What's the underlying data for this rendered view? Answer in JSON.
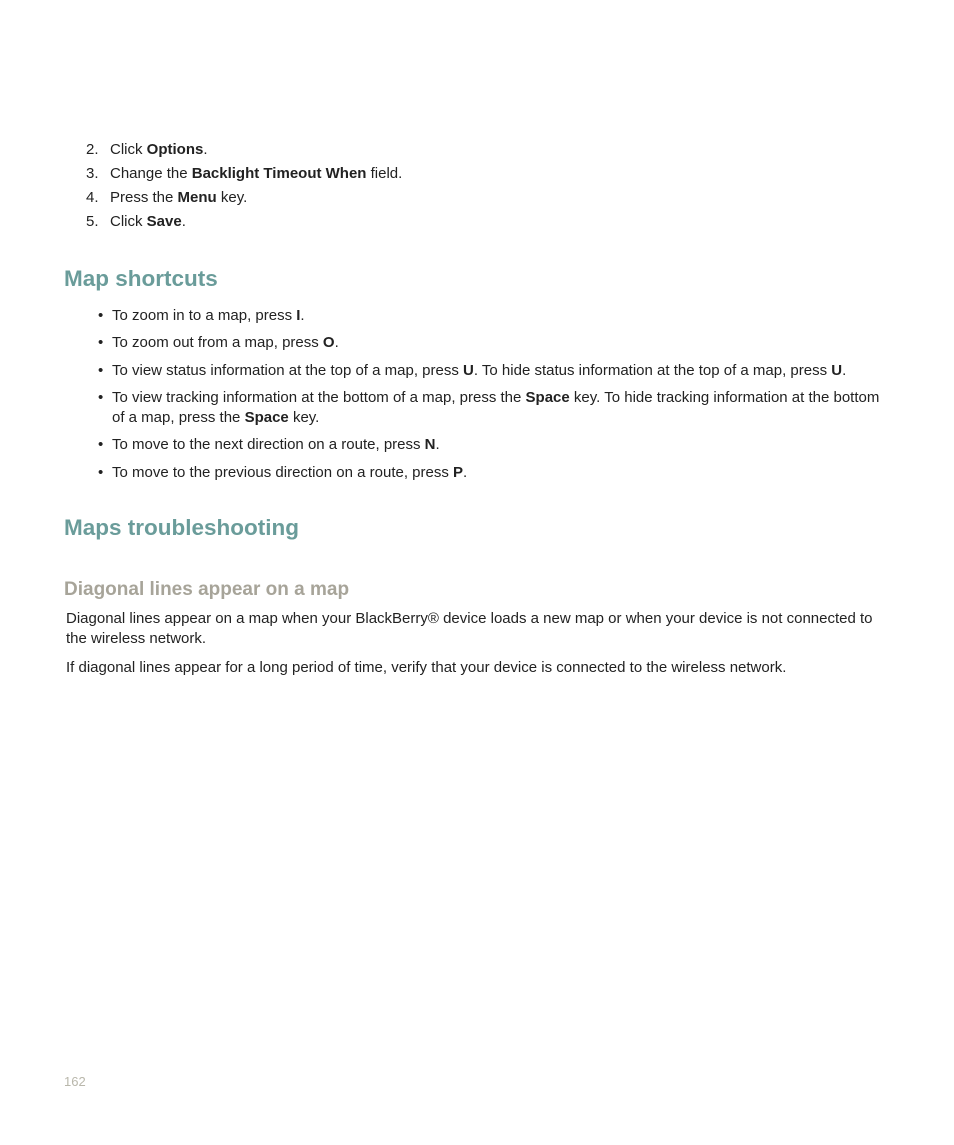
{
  "steps": [
    {
      "num": "2.",
      "parts": [
        "Click ",
        "Options",
        "."
      ]
    },
    {
      "num": "3.",
      "parts": [
        "Change the ",
        "Backlight Timeout When",
        " field."
      ]
    },
    {
      "num": "4.",
      "parts": [
        "Press the ",
        "Menu",
        " key."
      ]
    },
    {
      "num": "5.",
      "parts": [
        "Click ",
        "Save",
        "."
      ]
    }
  ],
  "section1": {
    "title": "Map shortcuts",
    "bullets": [
      [
        {
          "t": "To zoom in to a map, press "
        },
        {
          "t": "I",
          "b": true
        },
        {
          "t": "."
        }
      ],
      [
        {
          "t": "To zoom out from a map, press "
        },
        {
          "t": "O",
          "b": true
        },
        {
          "t": "."
        }
      ],
      [
        {
          "t": "To view status information at the top of a map, press "
        },
        {
          "t": "U",
          "b": true
        },
        {
          "t": ". To hide status information at the top of a map, press "
        },
        {
          "t": "U",
          "b": true
        },
        {
          "t": "."
        }
      ],
      [
        {
          "t": "To view tracking information at the bottom of a map, press the "
        },
        {
          "t": "Space",
          "b": true
        },
        {
          "t": " key. To hide tracking information at the bottom of a map, press the "
        },
        {
          "t": "Space",
          "b": true
        },
        {
          "t": " key."
        }
      ],
      [
        {
          "t": "To move to the next direction on a route, press "
        },
        {
          "t": "N",
          "b": true
        },
        {
          "t": "."
        }
      ],
      [
        {
          "t": "To move to the previous direction on a route, press "
        },
        {
          "t": "P",
          "b": true
        },
        {
          "t": "."
        }
      ]
    ]
  },
  "section2": {
    "title": "Maps troubleshooting",
    "sub": {
      "title": "Diagonal lines appear on a map",
      "paras": [
        "Diagonal lines appear on a map when your BlackBerry® device loads a new map or when your device is not connected to the wireless network.",
        "If diagonal lines appear for a long period of time, verify that your device is connected to the wireless network."
      ]
    }
  },
  "pageNumber": "162"
}
